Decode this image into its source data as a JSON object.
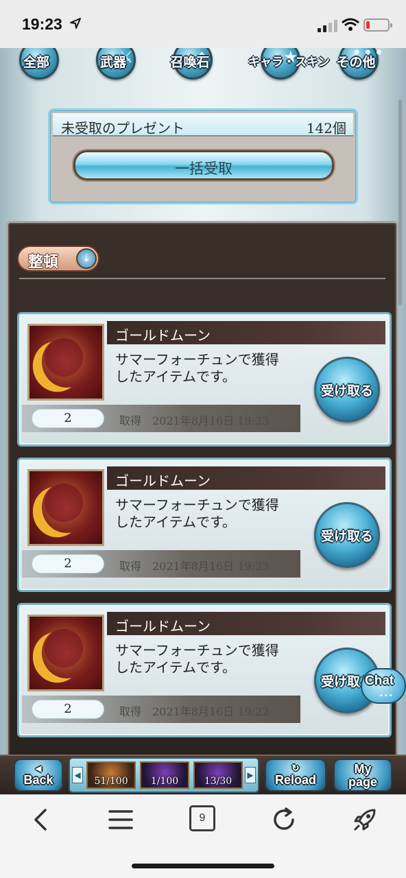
{
  "status_bar": {
    "time": "19:23"
  },
  "categories": [
    {
      "label": "全部",
      "icon": "all-icon"
    },
    {
      "label": "武器",
      "icon": "sword-icon"
    },
    {
      "label": "召喚石",
      "icon": "summon-stone-icon"
    },
    {
      "label": "キャラ・スキン",
      "icon": "character-skin-icon"
    },
    {
      "label": "その他",
      "icon": "more-icon"
    }
  ],
  "present": {
    "title": "未受取のプレゼント",
    "count": "142個",
    "bulk_button": "一括受取"
  },
  "sort": {
    "label": "整頓"
  },
  "items": [
    {
      "name": "ゴールドムーン",
      "desc_line1": "サマーフォーチュンで獲得",
      "desc_line2": "したアイテムです。",
      "quantity": "2",
      "acquired_label": "取得",
      "acquired_date": "2021年8月16日 19:23",
      "button": "受け取る"
    },
    {
      "name": "ゴールドムーン",
      "desc_line1": "サマーフォーチュンで獲得",
      "desc_line2": "したアイテムです。",
      "quantity": "2",
      "acquired_label": "取得",
      "acquired_date": "2021年8月16日 19:23",
      "button": "受け取る"
    },
    {
      "name": "ゴールドムーン",
      "desc_line1": "サマーフォーチュンで獲得",
      "desc_line2": "したアイテムです。",
      "quantity": "2",
      "acquired_label": "取得",
      "acquired_date": "2021年8月16日 19:22",
      "button": "受け取る"
    }
  ],
  "chat": {
    "label": "Chat"
  },
  "game_nav": {
    "back": "Back",
    "reload": "Reload",
    "mypage_line1": "My",
    "mypage_line2": "page",
    "slots": [
      "51/100",
      "1/100",
      "13/30"
    ]
  },
  "browser": {
    "tabs_count": "9"
  }
}
